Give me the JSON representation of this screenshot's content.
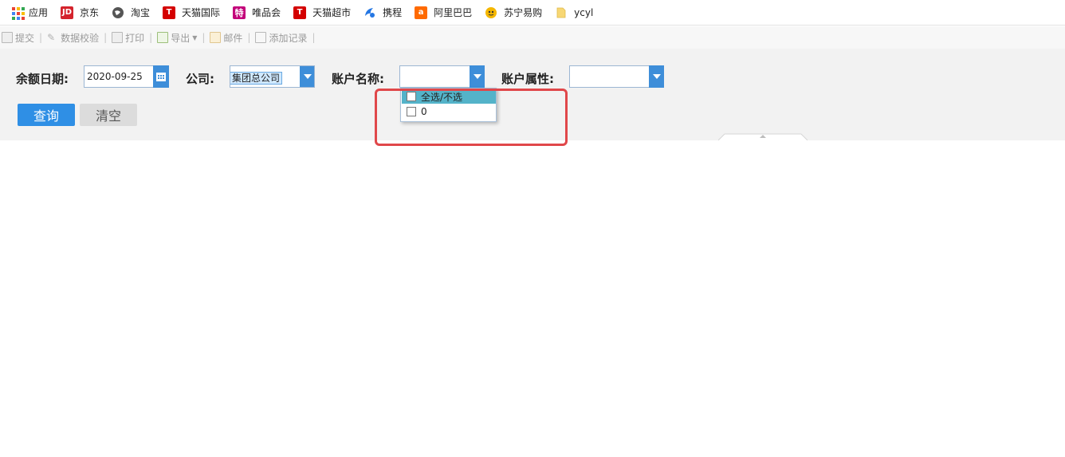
{
  "bookmarks": [
    {
      "label": "应用",
      "icon": "apps-grid-icon"
    },
    {
      "label": "京东",
      "icon": "jd-icon",
      "badge": "JD",
      "color": "#d4232c"
    },
    {
      "label": "淘宝",
      "icon": "taobao-globe-icon",
      "color": "#555555"
    },
    {
      "label": "天猫国际",
      "icon": "tmall-global-icon",
      "badge": "T",
      "color": "#d40000"
    },
    {
      "label": "唯品会",
      "icon": "vip-icon",
      "badge": "特",
      "color": "#c3007a"
    },
    {
      "label": "天猫超市",
      "icon": "tmall-supermarket-icon",
      "badge": "T",
      "color": "#d40000"
    },
    {
      "label": "携程",
      "icon": "ctrip-icon",
      "color": "#2577e3"
    },
    {
      "label": "阿里巴巴",
      "icon": "alibaba-icon",
      "badge": "a",
      "color": "#ff6a00"
    },
    {
      "label": "苏宁易购",
      "icon": "suning-icon",
      "color": "#f5b700"
    },
    {
      "label": "ycyl",
      "icon": "folder-icon",
      "color": "#f7d774"
    }
  ],
  "toolbar": {
    "submit": "提交",
    "validate": "数据校验",
    "print": "打印",
    "export": "导出",
    "mail": "邮件",
    "add_record": "添加记录"
  },
  "form": {
    "date_label": "余额日期:",
    "date_value": "2020-09-25",
    "company_label": "公司:",
    "company_value": "集团总公司",
    "account_name_label": "账户名称:",
    "account_name_value": "",
    "account_attr_label": "账户属性:",
    "account_attr_value": "",
    "query_button": "查询",
    "clear_button": "清空"
  },
  "dropdown": {
    "items": [
      {
        "label": "全选/不选",
        "checked": false,
        "highlighted": true
      },
      {
        "label": "0",
        "checked": false,
        "highlighted": false
      }
    ]
  },
  "colors": {
    "primary_button": "#2f8fe5",
    "combo_button": "#3e8ed9",
    "highlight": "#54b3c9",
    "annotation": "#e0474a"
  }
}
